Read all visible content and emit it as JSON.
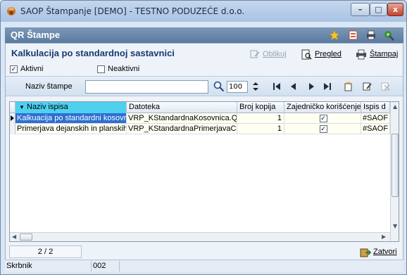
{
  "window": {
    "title": "SAOP Štampanje [DEMO] - TESTNO PODUZEĆE d.o.o.",
    "min_label": "–",
    "max_label": "□",
    "close_label": "x"
  },
  "header": {
    "title": "QR Štampe",
    "icons": [
      "star-icon",
      "export-icon",
      "printer-icon",
      "tools-icon"
    ]
  },
  "report": {
    "title": "Kalkulacija po standardnoj sastavnici"
  },
  "toolbar": {
    "format_label": "Oblikuj",
    "preview_label": "Pregled",
    "print_label": "Štampaj"
  },
  "filters": {
    "active_label": "Aktivni",
    "active_checked": true,
    "inactive_label": "Neaktivni",
    "inactive_checked": false
  },
  "search": {
    "label": "Naziv štampe",
    "value": "",
    "count": "100"
  },
  "table": {
    "columns": [
      "Naziv ispisa",
      "Datoteka",
      "Broj kopija",
      "Zajedničko korišćenje",
      "Ispis d"
    ],
    "rows": [
      {
        "name": "Kalkuacija po standardni kosovr",
        "file": "VRP_KStandardnaKosovnica.QR",
        "copies": "1",
        "shared": true,
        "print": "#SAOF"
      },
      {
        "name": "Primerjava dejanskih in planskih",
        "file": "VRP_KStandardnaPrimerjavaCe",
        "copies": "1",
        "shared": true,
        "print": "#SAOF"
      }
    ]
  },
  "footer": {
    "record_count": "2 / 2",
    "close_label": "Zatvori"
  },
  "status": {
    "user": "Skrbnik",
    "code": "002"
  },
  "colors": {
    "accent": "#163a72",
    "header_bg": "#6a88ad",
    "selected": "#2d6fd1",
    "sort_col": "#4fd0ef"
  }
}
